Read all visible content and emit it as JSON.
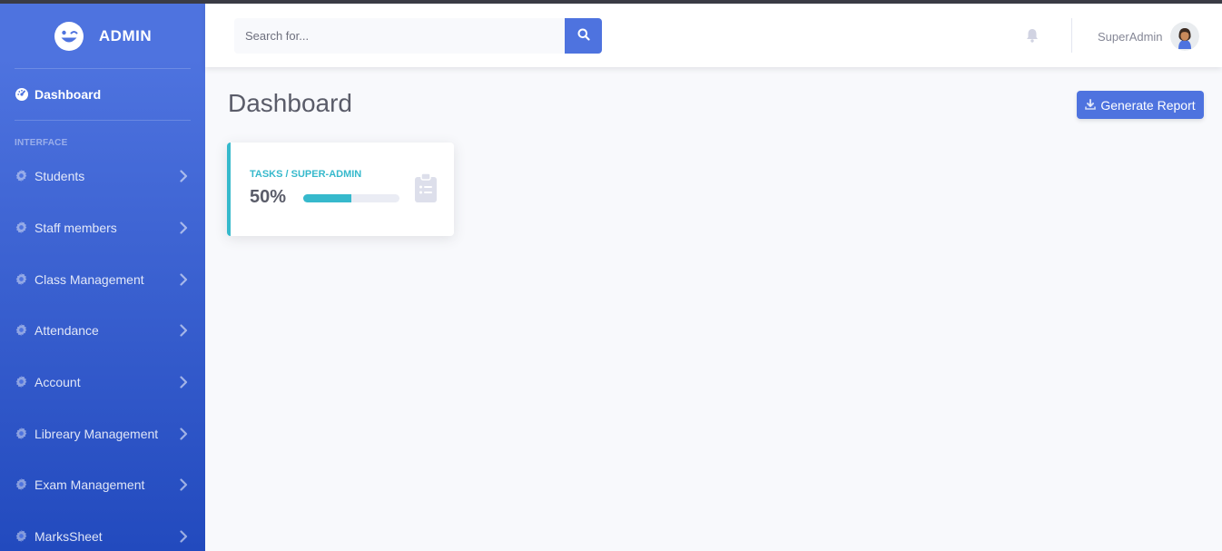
{
  "brand": {
    "name": "ADMIN"
  },
  "sidebar": {
    "dashboard": "Dashboard",
    "heading": "INTERFACE",
    "items": [
      {
        "label": "Students"
      },
      {
        "label": "Staff members"
      },
      {
        "label": "Class Management"
      },
      {
        "label": "Attendance"
      },
      {
        "label": "Account"
      },
      {
        "label": "Libreary Management"
      },
      {
        "label": "Exam Management"
      },
      {
        "label": "MarksSheet"
      }
    ]
  },
  "topbar": {
    "search_placeholder": "Search for...",
    "user_name": "SuperAdmin"
  },
  "main": {
    "title": "Dashboard",
    "generate_report": "Generate Report",
    "card": {
      "label": "TASKS / SUPER-ADMIN",
      "value": "50%",
      "progress_percent": 50
    }
  },
  "colors": {
    "primary": "#4e73df",
    "info": "#36b9cc",
    "text_dark": "#5a5c69",
    "muted": "#858796"
  },
  "icons": {
    "logo": "laugh-wink-icon",
    "dashboard": "tachometer-icon",
    "menu": "cog-icon",
    "chevron": "chevron-right-icon",
    "search": "search-icon",
    "bell": "bell-icon",
    "download": "download-icon",
    "clipboard": "clipboard-list-icon"
  }
}
